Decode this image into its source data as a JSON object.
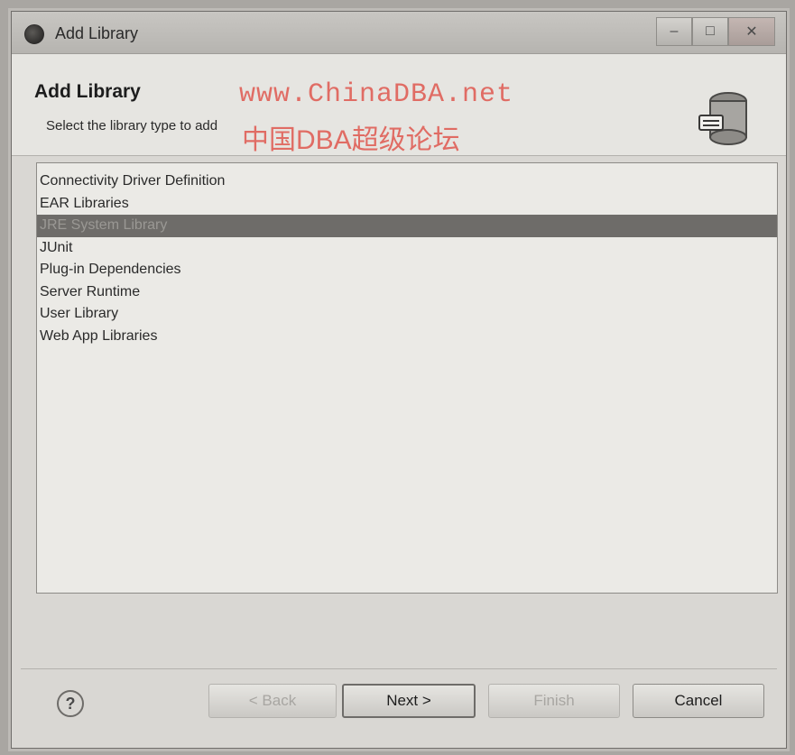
{
  "window": {
    "title": "Add Library"
  },
  "header": {
    "title": "Add Library",
    "description": "Select the library type to add",
    "watermark_url": "www.ChinaDBA.net",
    "watermark_cn": "中国DBA超级论坛"
  },
  "library_types": [
    {
      "label": "Connectivity Driver Definition",
      "selected": false
    },
    {
      "label": "EAR Libraries",
      "selected": false
    },
    {
      "label": "JRE System Library",
      "selected": true
    },
    {
      "label": "JUnit",
      "selected": false
    },
    {
      "label": "Plug-in Dependencies",
      "selected": false
    },
    {
      "label": "Server Runtime",
      "selected": false
    },
    {
      "label": "User Library",
      "selected": false
    },
    {
      "label": "Web App Libraries",
      "selected": false
    }
  ],
  "buttons": {
    "help": "?",
    "back": "< Back",
    "next": "Next >",
    "finish": "Finish",
    "cancel": "Cancel"
  },
  "icons": {
    "app": "eclipse-icon",
    "banner": "library-jar-icon"
  }
}
